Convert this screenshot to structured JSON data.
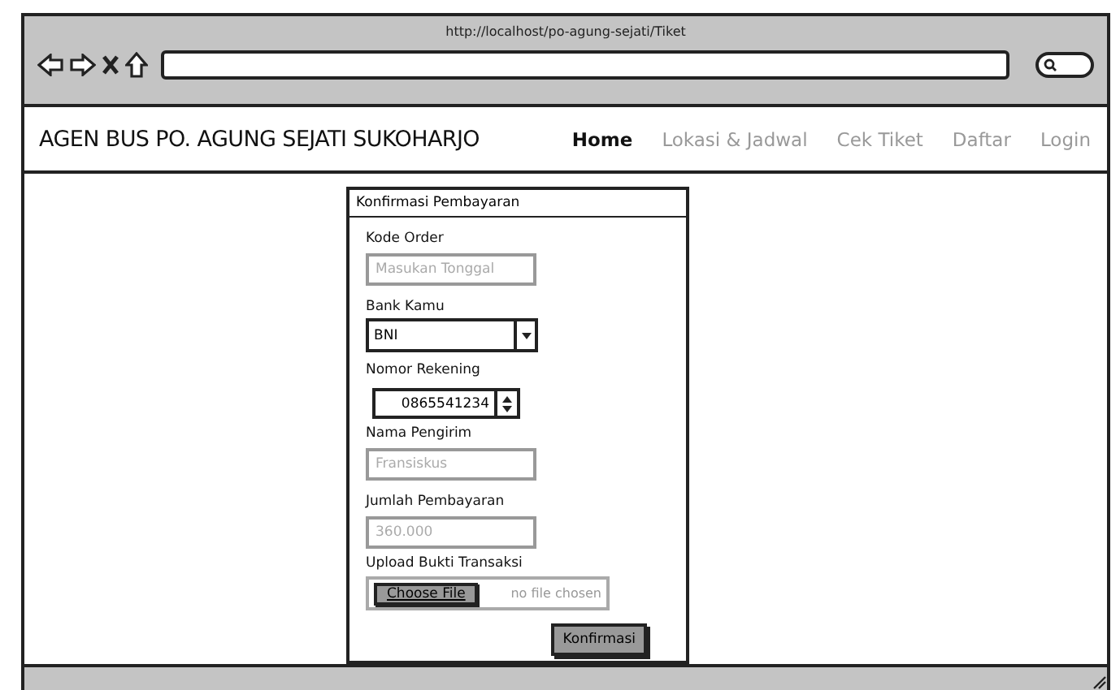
{
  "browser": {
    "url": "http://localhost/po-agung-sejati/Tiket"
  },
  "header": {
    "brand": "AGEN BUS PO. AGUNG SEJATI SUKOHARJO",
    "nav": [
      {
        "label": "Home",
        "selected": true
      },
      {
        "label": "Lokasi & Jadwal",
        "selected": false
      },
      {
        "label": "Cek Tiket",
        "selected": false
      },
      {
        "label": "Daftar",
        "selected": false
      },
      {
        "label": "Login",
        "selected": false
      }
    ]
  },
  "form": {
    "title": "Konfirmasi Pembayaran",
    "fields": [
      {
        "kind": "text",
        "label": "Kode Order",
        "placeholder": "Masukan Tonggal"
      },
      {
        "kind": "select",
        "label": "Bank Kamu",
        "value": "BNI"
      },
      {
        "kind": "number",
        "label": "Nomor Rekening",
        "value": "0865541234"
      },
      {
        "kind": "text",
        "label": "Nama Pengirim",
        "placeholder": "Fransiskus"
      },
      {
        "kind": "text",
        "label": "Jumlah Pembayaran",
        "placeholder": "360.000"
      },
      {
        "kind": "file",
        "label": "Upload Bukti Transaksi",
        "button": "Choose File",
        "status": "no file chosen"
      }
    ],
    "submit": "Konfirmasi"
  }
}
